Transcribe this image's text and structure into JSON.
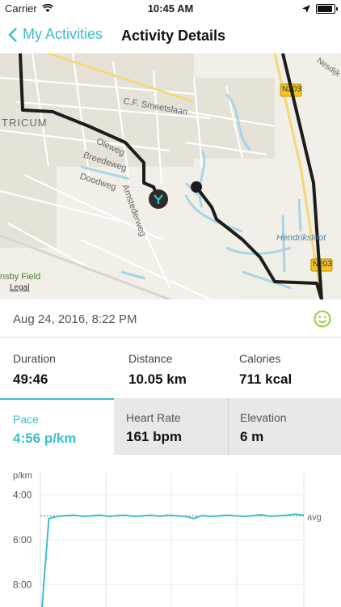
{
  "status_bar": {
    "carrier": "Carrier",
    "time": "10:45 AM",
    "battery_level": 0.9
  },
  "nav": {
    "back_label": "My Activities",
    "title": "Activity Details"
  },
  "map": {
    "labels": {
      "street_smeetslaan": "C.F. Smeetslaan",
      "area_tricum": "TRICUM",
      "street_breedeweg": "Breedeweg",
      "street_doodweg": "Doodweg",
      "street_oleweg": "Oleweg",
      "street_amstederweg": "Amstederweg",
      "water_hendriksloot": "Hendriksloot",
      "street_nesdijk": "Nesdijk",
      "road_n203_top": "N203",
      "road_n203_bottom": "N203",
      "field": "nsby Field",
      "legal": "Legal"
    }
  },
  "activity": {
    "date": "Aug 24, 2016, 8:22 PM",
    "stats": {
      "duration": {
        "label": "Duration",
        "value": "49:46"
      },
      "distance": {
        "label": "Distance",
        "value": "10.05 km"
      },
      "calories": {
        "label": "Calories",
        "value": "711 kcal"
      },
      "pace": {
        "label": "Pace",
        "value": "4:56 p/km"
      },
      "heart_rate": {
        "label": "Heart Rate",
        "value": "161 bpm"
      },
      "elevation": {
        "label": "Elevation",
        "value": "6 m"
      }
    }
  },
  "colors": {
    "accent": "#3cbfcb",
    "route": "#1c1c1c",
    "mood": "#9cc83a"
  },
  "chart_data": {
    "type": "line",
    "ylabel": "p/km",
    "ytick_labels": [
      "4:00",
      "6:00",
      "8:00"
    ],
    "avg_label": "avg",
    "y_inverted": true,
    "ylim_minutes": [
      3,
      9
    ],
    "series": [
      {
        "values_minutes": [
          9.2,
          5.05,
          4.95,
          4.92,
          4.9,
          4.95,
          4.93,
          4.9,
          4.95,
          4.92,
          4.9,
          4.95,
          4.93,
          4.9,
          4.95,
          4.9,
          4.93,
          4.95,
          5.05,
          4.92,
          4.95,
          4.93,
          4.9,
          4.93,
          4.95,
          4.92,
          4.88,
          4.95,
          4.93,
          4.9,
          4.85,
          4.9
        ]
      }
    ],
    "avg_minutes": 4.93
  }
}
